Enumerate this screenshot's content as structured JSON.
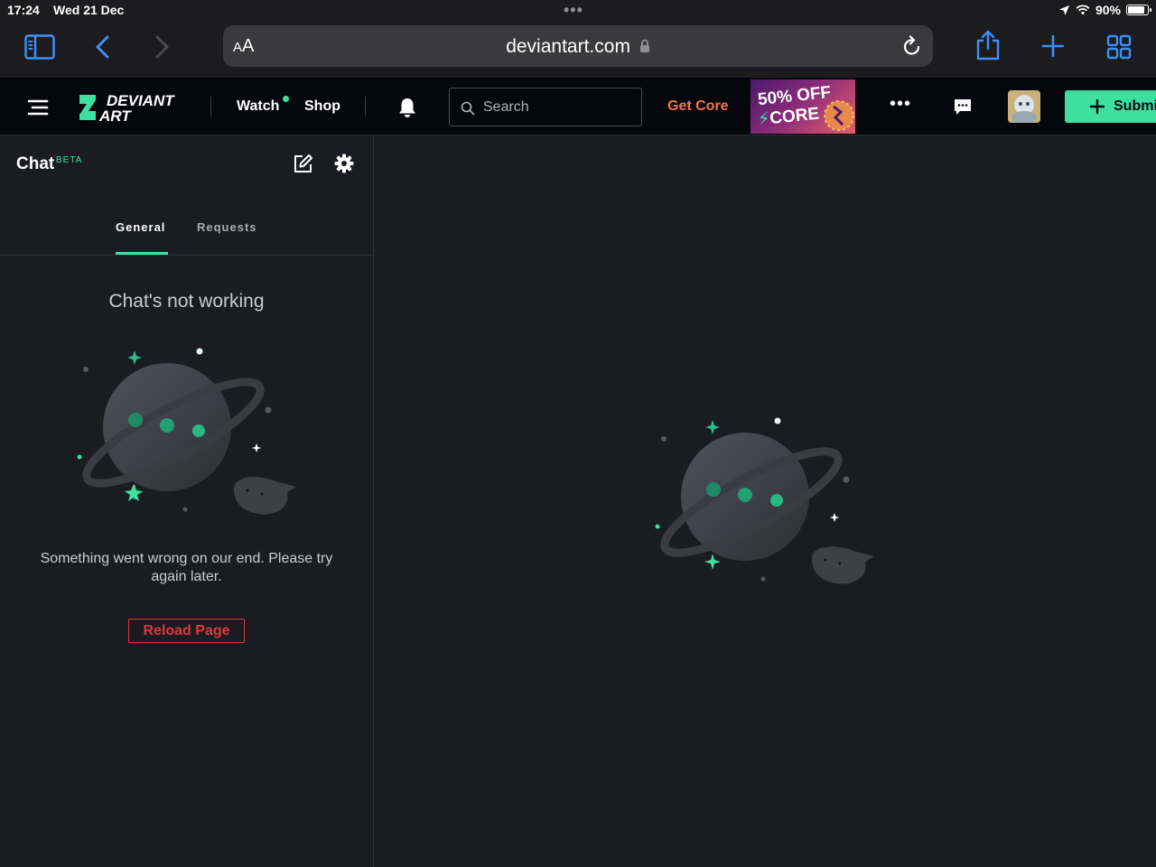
{
  "status_bar": {
    "time": "17:24",
    "date": "Wed 21 Dec",
    "battery": "90%",
    "battery_level": 0.9
  },
  "browser": {
    "aa_label_small": "A",
    "aa_label_large": "A",
    "url": "deviantart.com"
  },
  "header": {
    "nav": {
      "watch": "Watch",
      "shop": "Shop"
    },
    "search_placeholder": "Search",
    "get_core": "Get Core",
    "promo": {
      "line1": "50% OFF",
      "line2": "CORE"
    },
    "submit_label": "Submi",
    "accent_color": "#3ee0a0"
  },
  "chat": {
    "title": "Chat",
    "beta": "BETA",
    "tabs": {
      "general": "General",
      "requests": "Requests"
    },
    "error_title": "Chat's not working",
    "error_message": "Something went wrong on our end. Please try again later.",
    "reload_label": "Reload Page"
  },
  "colors": {
    "background": "#1a1c21",
    "header_bg": "#06070d",
    "error_red": "#e0363f",
    "get_core_orange": "#f7704f"
  }
}
